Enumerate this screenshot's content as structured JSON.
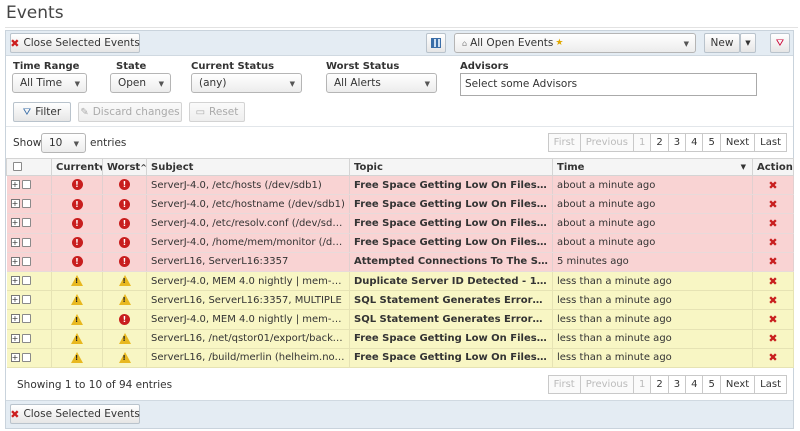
{
  "page": {
    "title": "Events"
  },
  "toolbar": {
    "close_selected_label": "Close Selected Events",
    "view_select": "All Open Events",
    "new_label": "New"
  },
  "filters": {
    "time_range": {
      "label": "Time Range",
      "value": "All Time"
    },
    "state": {
      "label": "State",
      "value": "Open"
    },
    "current_status": {
      "label": "Current Status",
      "value": "(any)"
    },
    "worst_status": {
      "label": "Worst Status",
      "value": "All Alerts"
    },
    "advisors": {
      "label": "Advisors",
      "placeholder": "Select some Advisors"
    },
    "filter_button": "Filter",
    "discard_button": "Discard changes",
    "reset_button": "Reset"
  },
  "length": {
    "show": "Show",
    "value": "10",
    "entries": "entries"
  },
  "pagination": {
    "first": "First",
    "previous": "Previous",
    "pages": [
      "1",
      "2",
      "3",
      "4",
      "5"
    ],
    "next": "Next",
    "last": "Last"
  },
  "table": {
    "headers": {
      "current": "Current",
      "worst": "Worst",
      "subject": "Subject",
      "topic": "Topic",
      "time": "Time",
      "actions": "Actions"
    },
    "rows": [
      {
        "current": "critical",
        "worst": "critical",
        "subject": "ServerJ-4.0, /etc/hosts (/dev/sdb1)",
        "topic": "Free Space Getting Low On Filesystem ...",
        "time": "about a minute ago"
      },
      {
        "current": "critical",
        "worst": "critical",
        "subject": "ServerJ-4.0, /etc/hostname (/dev/sdb1)",
        "topic": "Free Space Getting Low On Filesystem ...",
        "time": "about a minute ago"
      },
      {
        "current": "critical",
        "worst": "critical",
        "subject": "ServerJ-4.0, /etc/resolv.conf (/dev/sdb1)",
        "topic": "Free Space Getting Low On Filesystem ...",
        "time": "about a minute ago"
      },
      {
        "current": "critical",
        "worst": "critical",
        "subject": "ServerJ-4.0, /home/mem/monitor (/dev/...",
        "topic": "Free Space Getting Low On Filesystem ...",
        "time": "about a minute ago"
      },
      {
        "current": "critical",
        "worst": "critical",
        "subject": "ServerL16, ServerL16:3357",
        "topic": "Attempted Connections To The Server ...",
        "time": "5 minutes ago"
      },
      {
        "current": "warning",
        "worst": "warning",
        "subject": "ServerJ-4.0, MEM 4.0 nightly | mem-nigh...",
        "topic": "Duplicate Server ID Detected - 1234567...",
        "time": "less than a minute ago"
      },
      {
        "current": "warning",
        "worst": "warning",
        "subject": "ServerL16, ServerL16:3357, MULTIPLE",
        "topic": "SQL Statement Generates Errors or Wa...",
        "time": "less than a minute ago"
      },
      {
        "current": "warning",
        "worst": "critical",
        "subject": "ServerJ-4.0, MEM 4.0 nightly | mem-nigh...",
        "topic": "SQL Statement Generates Errors or Wa...",
        "time": "less than a minute ago"
      },
      {
        "current": "warning",
        "worst": "warning",
        "subject": "ServerL16, /net/qstor01/export/backupr...",
        "topic": "Free Space Getting Low On Filesystem ...",
        "time": "less than a minute ago"
      },
      {
        "current": "warning",
        "worst": "warning",
        "subject": "ServerL16, /build/merlin (helheim.no.or...",
        "topic": "Free Space Getting Low On Filesystem ...",
        "time": "less than a minute ago"
      }
    ]
  },
  "info": {
    "text": "Showing 1 to 10 of 94 entries"
  },
  "footer": {
    "close_selected_label": "Close Selected Events"
  }
}
